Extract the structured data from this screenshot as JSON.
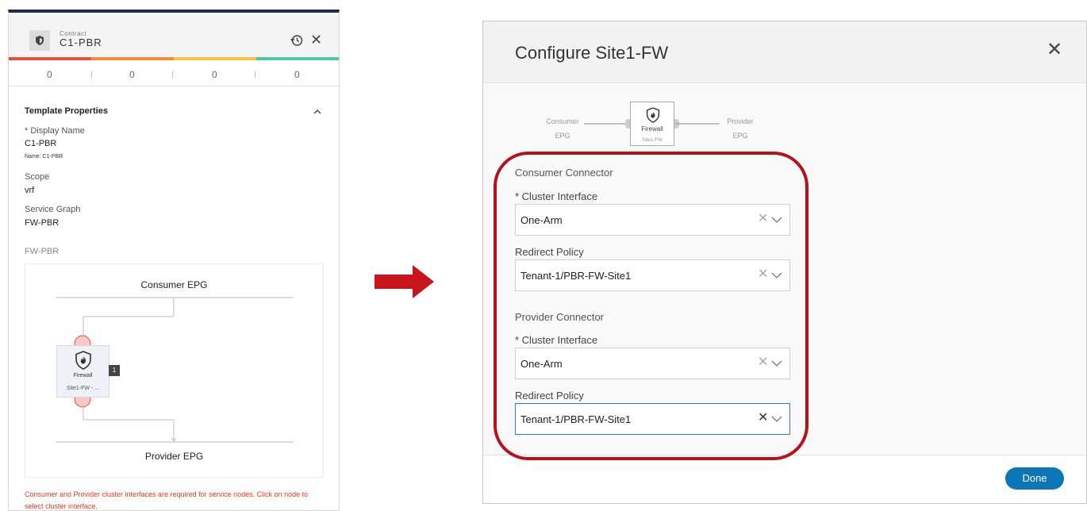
{
  "left_panel": {
    "contract_type": "Contract",
    "contract_name": "C1-PBR",
    "health_colors": [
      "#e5533d",
      "#f28c38",
      "#f6c344",
      "#4cc8a9"
    ],
    "counts": [
      "0",
      "0",
      "0",
      "0"
    ],
    "template_properties_title": "Template Properties",
    "display_name_label": "* Display Name",
    "display_name_value": "C1-PBR",
    "name_sub": "Name: C1-PBR",
    "scope_label": "Scope",
    "scope_value": "vrf",
    "service_graph_label": "Service Graph",
    "service_graph_value": "FW-PBR",
    "graph_label": "FW-PBR",
    "consumer_epg": "Consumer EPG",
    "provider_epg": "Provider EPG",
    "node_label": "Firewall",
    "node_sub": "Site1-FW - ...",
    "node_badge": "1",
    "error_message": "Consumer and Provider cluster interfaces are required for service nodes. Click on node to select cluster interface."
  },
  "dialog": {
    "title": "Configure Site1-FW",
    "diagram": {
      "consumer_line1": "Consumer",
      "consumer_line2": "EPG",
      "provider_line1": "Provider",
      "provider_line2": "EPG",
      "node_label": "Firewall",
      "node_sub": "Site1-FW"
    },
    "consumer_connector": {
      "title": "Consumer Connector",
      "cluster_interface_label": "* Cluster Interface",
      "cluster_interface_value": "One-Arm",
      "redirect_policy_label": "Redirect Policy",
      "redirect_policy_value": "Tenant-1/PBR-FW-Site1"
    },
    "provider_connector": {
      "title": "Provider Connector",
      "cluster_interface_label": "* Cluster Interface",
      "cluster_interface_value": "One-Arm",
      "redirect_policy_label": "Redirect Policy",
      "redirect_policy_value": "Tenant-1/PBR-FW-Site1"
    },
    "done_label": "Done"
  },
  "colors": {
    "accent": "#0d76b6",
    "highlight": "#b5121b",
    "arrow": "#c8141c",
    "error": "#e23a1e"
  }
}
